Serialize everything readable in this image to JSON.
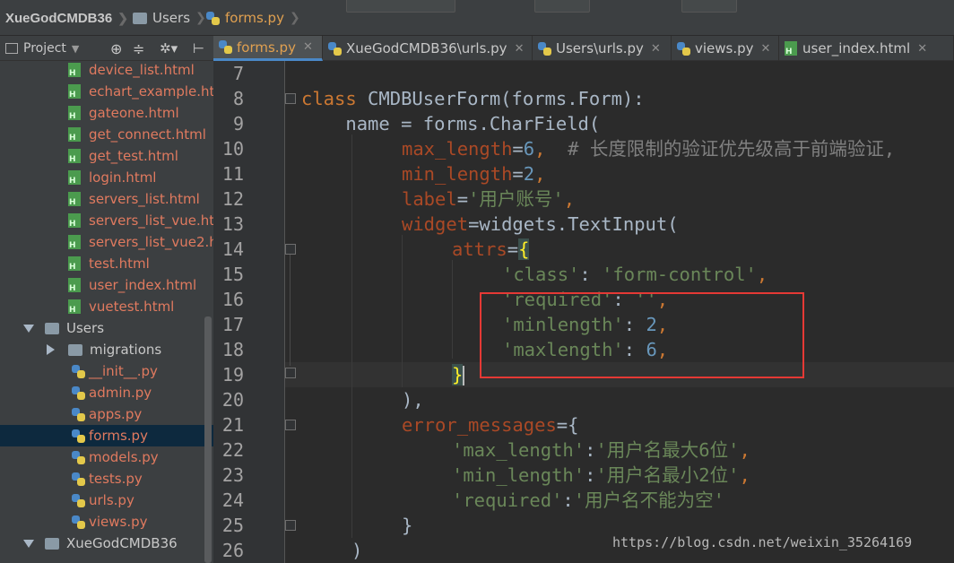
{
  "navbar": {
    "project": "XueGodCMDB36",
    "folder": "Users",
    "file": "forms.py"
  },
  "project_panel": {
    "title": "Project"
  },
  "tabs": [
    {
      "label": "forms.py",
      "active": true
    },
    {
      "label": "XueGodCMDB36\\urls.py",
      "active": false
    },
    {
      "label": "Users\\urls.py",
      "active": false
    },
    {
      "label": "views.py",
      "active": false
    },
    {
      "label": "user_index.html",
      "active": false
    }
  ],
  "tree": [
    {
      "label": "device_list.html",
      "type": "html"
    },
    {
      "label": "echart_example.htm",
      "type": "html"
    },
    {
      "label": "gateone.html",
      "type": "html"
    },
    {
      "label": "get_connect.html",
      "type": "html"
    },
    {
      "label": "get_test.html",
      "type": "html"
    },
    {
      "label": "login.html",
      "type": "html"
    },
    {
      "label": "servers_list.html",
      "type": "html"
    },
    {
      "label": "servers_list_vue.htm",
      "type": "html"
    },
    {
      "label": "servers_list_vue2.ht",
      "type": "html"
    },
    {
      "label": "test.html",
      "type": "html"
    },
    {
      "label": "user_index.html",
      "type": "html"
    },
    {
      "label": "vuetest.html",
      "type": "html"
    },
    {
      "label": "Users",
      "type": "folder-open"
    },
    {
      "label": "migrations",
      "type": "folder-closed"
    },
    {
      "label": "__init__.py",
      "type": "py"
    },
    {
      "label": "admin.py",
      "type": "py"
    },
    {
      "label": "apps.py",
      "type": "py"
    },
    {
      "label": "forms.py",
      "type": "py",
      "selected": true
    },
    {
      "label": "models.py",
      "type": "py"
    },
    {
      "label": "tests.py",
      "type": "py"
    },
    {
      "label": "urls.py",
      "type": "py"
    },
    {
      "label": "views.py",
      "type": "py"
    },
    {
      "label": "XueGodCMDB36",
      "type": "folder-open"
    }
  ],
  "line_numbers": [
    "7",
    "8",
    "9",
    "10",
    "11",
    "12",
    "13",
    "14",
    "15",
    "16",
    "17",
    "18",
    "19",
    "20",
    "21",
    "22",
    "23",
    "24",
    "25",
    "26"
  ],
  "code": {
    "l8_kw": "class",
    "l8_rest": " CMDBUserForm(forms.Form):",
    "l9": "    name = forms.CharField(",
    "l10_param": "max_length",
    "l10_eq": "=",
    "l10_num": "6",
    "l10_comma": ",  ",
    "l10_cmt": "# 长度限制的验证优先级高于前端验证,",
    "l11_param": "min_length",
    "l11_eq": "=",
    "l11_num": "2",
    "l11_comma": ",",
    "l12_param": "label",
    "l12_eq": "=",
    "l12_str": "'用户账号'",
    "l12_comma": ",",
    "l13_param": "widget",
    "l13_rest": "=widgets.TextInput(",
    "l14_param": "attrs",
    "l14_eq": "=",
    "l14_brace": "{",
    "l15_key": "'class'",
    "l15_colon": ": ",
    "l15_val": "'form-control'",
    "l15_comma": ",",
    "l16_key": "'required'",
    "l16_colon": ": ",
    "l16_val": "''",
    "l16_comma": ",",
    "l17_key": "'minlength'",
    "l17_colon": ": ",
    "l17_num": "2",
    "l17_comma": ",",
    "l18_key": "'maxlength'",
    "l18_colon": ": ",
    "l18_num": "6",
    "l18_comma": ",",
    "l19_brace": "}",
    "l20": "),",
    "l21_param": "error_messages",
    "l21_rest": "={",
    "l22_key": "'max_length'",
    "l22_colon": ":",
    "l22_val": "'用户名最大6位'",
    "l22_comma": ",",
    "l23_key": "'min_length'",
    "l23_colon": ":",
    "l23_val": "'用户名最小2位'",
    "l23_comma": ",",
    "l24_key": "'required'",
    "l24_colon": ":",
    "l24_val": "'用户名不能为空'",
    "l25": "}",
    "l26": ")"
  },
  "watermark": "https://blog.csdn.net/weixin_35264169"
}
